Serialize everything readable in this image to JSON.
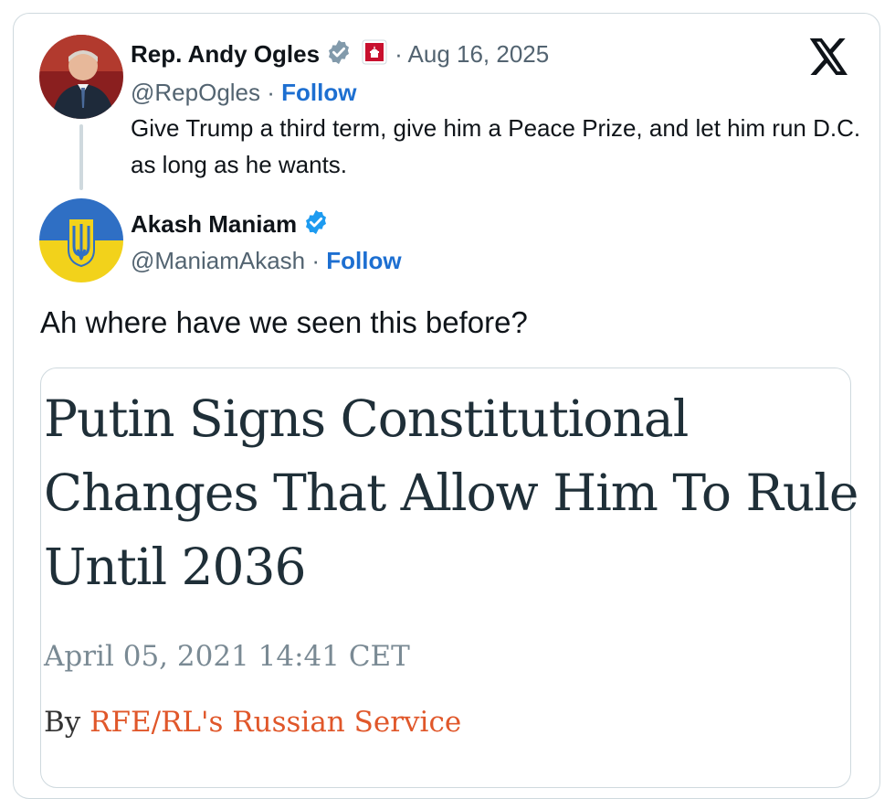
{
  "card": {
    "original_tweet": {
      "author_name": "Rep. Andy Ogles",
      "handle": "@RepOgles",
      "date": "Aug 16, 2025",
      "follow_label": "Follow",
      "text": "Give Trump a third term, give him a Peace Prize, and let him run D.C. as long as he wants.",
      "verified_badge_icon": "verified-gray-badge-icon",
      "affiliation_icon": "capitol-affiliation-icon"
    },
    "reply_tweet": {
      "author_name": "Akash Maniam",
      "handle": "@ManiamAkash",
      "follow_label": "Follow",
      "verified_badge_icon": "verified-blue-badge-icon",
      "text": "Ah where have we seen this before?"
    },
    "article": {
      "headline": "Putin Signs Constitutional Changes That Allow Him To Rule Until 2036",
      "date": "April 05, 2021 14:41 CET",
      "by_label": "By",
      "author": "RFE/RL's Russian Service"
    },
    "brand_icon": "x-logo-icon"
  },
  "colors": {
    "follow_blue": "#1d9bf0",
    "muted_gray": "#536471",
    "border": "#cfd9de",
    "author_orange": "#e0572a",
    "headline": "#1f2f38"
  }
}
